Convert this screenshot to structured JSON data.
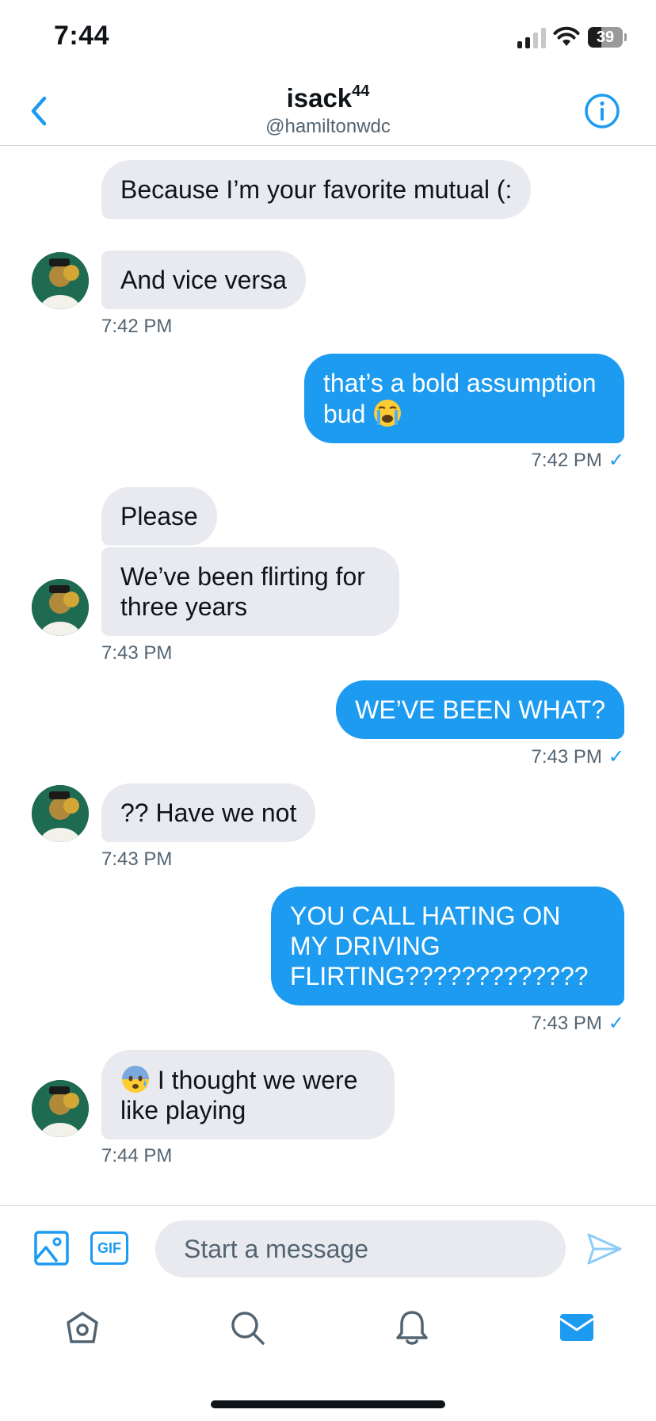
{
  "status_bar": {
    "time": "7:44",
    "battery": "39",
    "battery_level": 0.39
  },
  "header": {
    "name": "isack",
    "name_sup": "44",
    "handle": "@hamiltonwdc"
  },
  "messages": [
    {
      "text": "Because I’m your favorite mutual (:"
    },
    {
      "text": "And vice versa"
    },
    {
      "time": "7:42 PM"
    },
    {
      "text": "that’s a bold assumption bud",
      "emoji": "loudly-crying-face"
    },
    {
      "time": "7:42 PM",
      "check": "✓"
    },
    {
      "text": "Please"
    },
    {
      "text": "We’ve been flirting for three years"
    },
    {
      "time": "7:43 PM"
    },
    {
      "text": "WE’VE BEEN WHAT?"
    },
    {
      "time": "7:43 PM",
      "check": "✓"
    },
    {
      "text": "?? Have we not"
    },
    {
      "time": "7:43 PM"
    },
    {
      "text": "YOU CALL HATING ON MY DRIVING FLIRTING?????????????"
    },
    {
      "time": "7:43 PM",
      "check": "✓"
    },
    {
      "text": "I thought we were like playing",
      "emoji": "anxious-face"
    },
    {
      "time": "7:44 PM"
    }
  ],
  "composer": {
    "placeholder": "Start a message",
    "gif_label": "GIF"
  },
  "colors": {
    "accent": "#1d9bf0",
    "incoming_bubble": "#e8eaef",
    "muted": "#536471"
  },
  "nav": {
    "items": [
      "home-icon",
      "search-icon",
      "notifications-icon",
      "messages-icon"
    ],
    "active": "messages-icon"
  }
}
